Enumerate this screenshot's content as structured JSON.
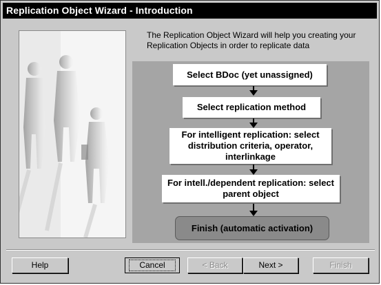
{
  "window": {
    "title": "Replication Object Wizard - Introduction"
  },
  "intro": {
    "text": "The Replication Object Wizard will help you creating your Replication Objects in order to replicate data"
  },
  "steps": [
    {
      "label": "Select BDoc (yet unassigned)"
    },
    {
      "label": "Select replication method"
    },
    {
      "label": "For intelligent replication: select distribution criteria, operator, interlinkage"
    },
    {
      "label": "For intell./dependent replication: select parent object"
    },
    {
      "label": "Finish (automatic activation)"
    }
  ],
  "buttons": {
    "help": "Help",
    "cancel": "Cancel",
    "back": "< Back",
    "next": "Next >",
    "finish": "Finish"
  },
  "colors": {
    "titlebar": "#000000",
    "dialog_bg": "#c9c9c9",
    "flow_bg": "#a5a5a5",
    "final_step": "#8a8a8a"
  }
}
